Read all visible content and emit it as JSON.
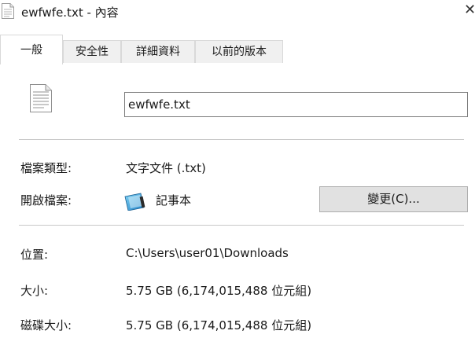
{
  "window": {
    "title": "ewfwfe.txt - 內容",
    "close_glyph": "✕",
    "icon": "text-file-icon"
  },
  "tabs": [
    {
      "label": "一般",
      "active": true
    },
    {
      "label": "安全性",
      "active": false
    },
    {
      "label": "詳細資料",
      "active": false
    },
    {
      "label": "以前的版本",
      "active": false
    }
  ],
  "general": {
    "file_icon": "text-file-icon",
    "file_name": "ewfwfe.txt",
    "file_type_label": "檔案類型:",
    "file_type_value": "文字文件 (.txt)",
    "opens_with_label": "開啟檔案:",
    "opens_with_app": "記事本",
    "opens_with_app_icon": "notepad-icon",
    "change_button": "變更(C)...",
    "location_label": "位置:",
    "location_value": "C:\\Users\\user01\\Downloads",
    "size_label": "大小:",
    "size_value": "5.75 GB (6,174,015,488 位元組)",
    "size_on_disk_label": "磁碟大小:",
    "size_on_disk_value": "5.75 GB (6,174,015,488 位元組)"
  }
}
